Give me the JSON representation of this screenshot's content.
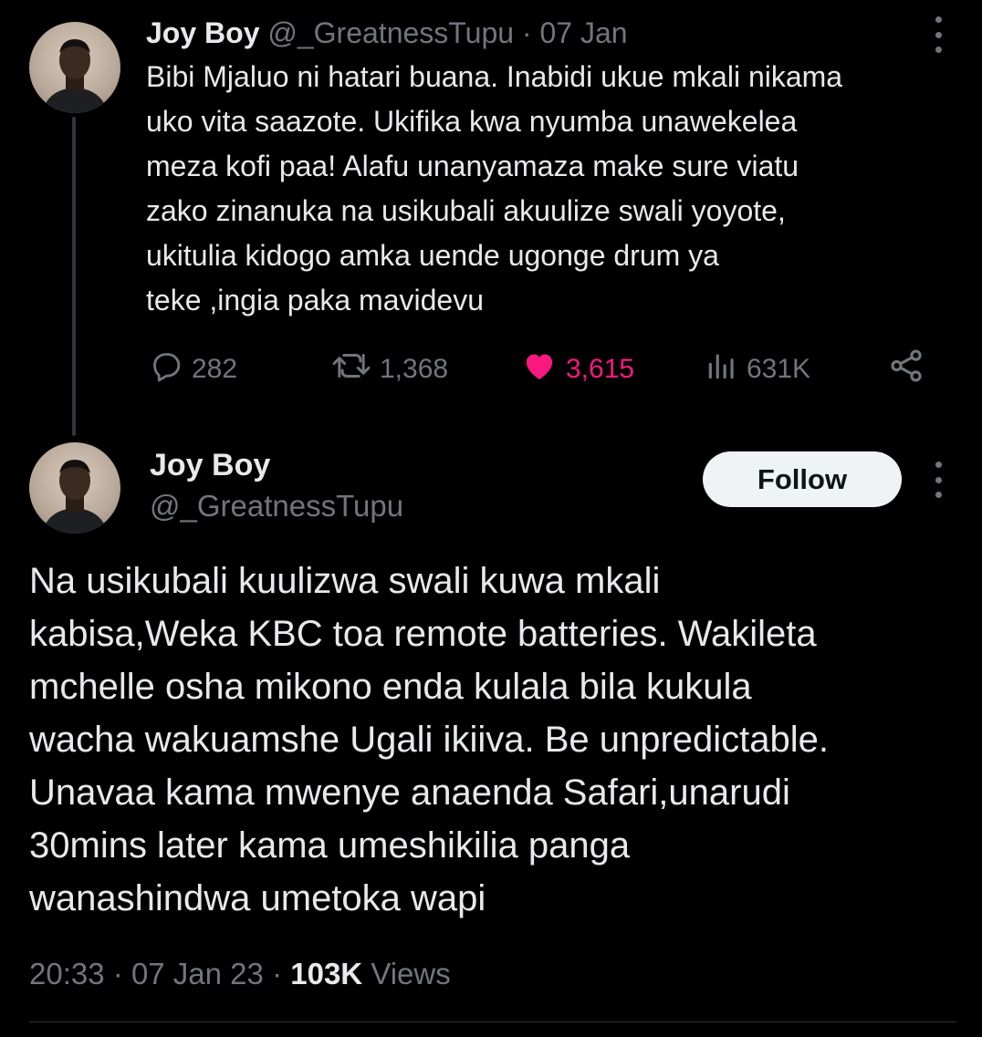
{
  "parent_tweet": {
    "name": "Joy Boy",
    "handle": "@_GreatnessTupu",
    "separator": "·",
    "date": "07 Jan",
    "text": "Bibi Mjaluo ni hatari buana. Inabidi ukue mkali nikama\nuko vita saazote. Ukifika kwa nyumba unawekelea\nmeza kofi paa! Alafu unanyamaza make sure viatu\nzako zinanuka na usikubali akuulize swali yoyote,\nukitulia kidogo amka uende ugonge drum ya\nteke ,ingia paka mavidevu",
    "actions": {
      "replies": "282",
      "retweets": "1,368",
      "likes": "3,615",
      "views": "631K"
    },
    "icons": [
      "avatar",
      "more-icon",
      "reply-icon",
      "retweet-icon",
      "heart-icon",
      "views-icon",
      "share-icon"
    ]
  },
  "main_tweet": {
    "name": "Joy Boy",
    "handle": "@_GreatnessTupu",
    "follow_label": "Follow",
    "text": "Na usikubali kuulizwa swali kuwa mkali\nkabisa,Weka KBC toa remote batteries. Wakileta\nmchelle osha mikono enda kulala bila kukula\nwacha wakuamshe Ugali ikiiva. Be unpredictable.\nUnavaa kama mwenye anaenda Safari,unarudi\n30mins later kama umeshikilia panga\nwanashindwa umetoka wapi",
    "time": "20:33",
    "separator": "·",
    "date": "07 Jan 23",
    "views_count": "103K",
    "views_label": "Views"
  },
  "colors": {
    "background": "#000000",
    "text_primary": "#e7e9ea",
    "text_secondary": "#71767b",
    "like_active": "#f91880",
    "follow_bg": "#eff3f4"
  }
}
